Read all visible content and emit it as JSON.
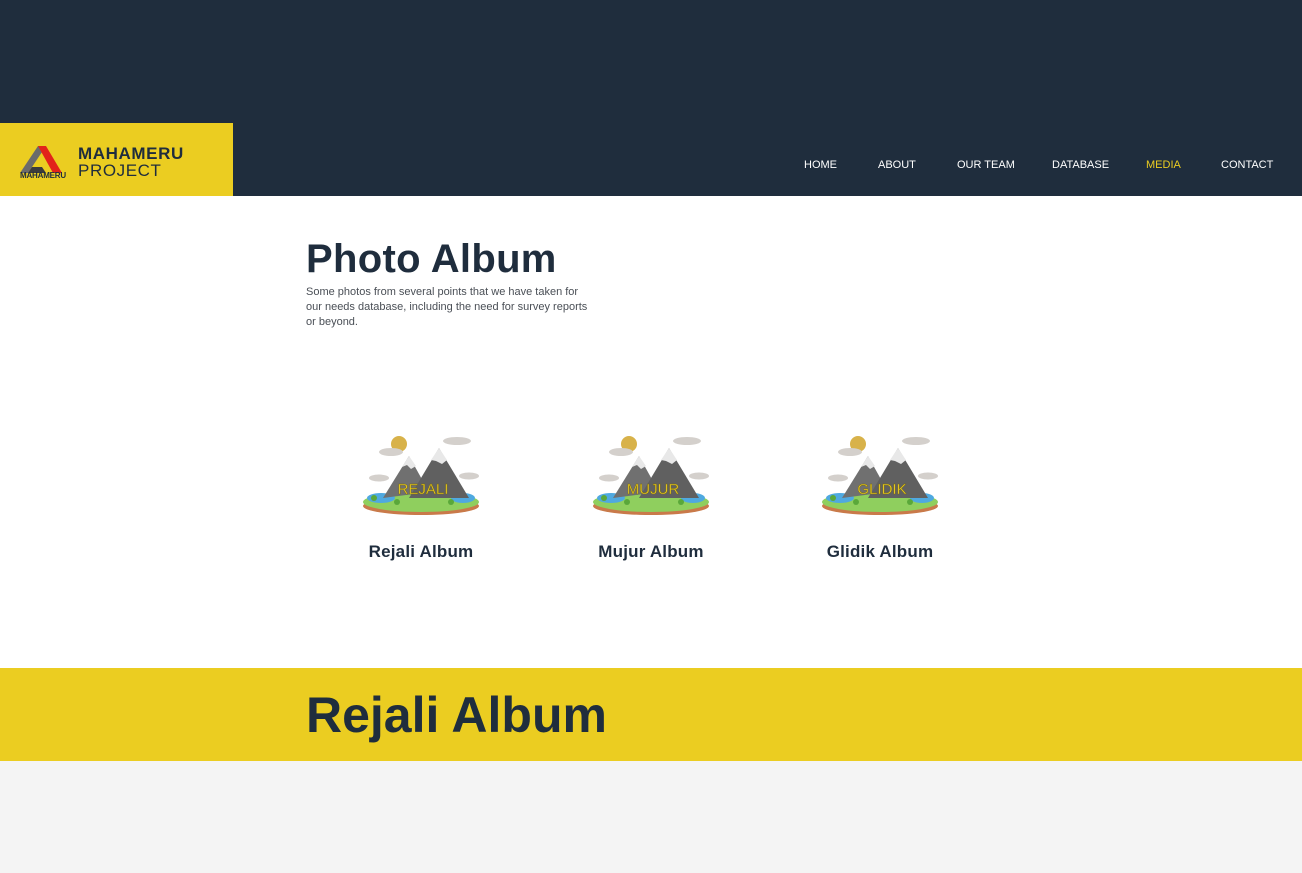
{
  "brand": {
    "name": "MAHAMERU",
    "sub": "PROJECT",
    "mark_caption": "MAHAMERU"
  },
  "nav": {
    "items": [
      {
        "label": "HOME"
      },
      {
        "label": "ABOUT"
      },
      {
        "label": "OUR TEAM"
      },
      {
        "label": "DATABASE"
      },
      {
        "label": "MEDIA",
        "active": true
      },
      {
        "label": "CONTACT"
      }
    ]
  },
  "main": {
    "title": "Photo Album",
    "description": "Some photos from several points that we have taken for our needs database, including the need for survey reports or beyond.",
    "albums": [
      {
        "badge": "REJALI",
        "title": "Rejali Album"
      },
      {
        "badge": "MUJUR",
        "title": "Mujur Album"
      },
      {
        "badge": "GLIDIK",
        "title": "Glidik Album"
      }
    ]
  },
  "banner": {
    "title": "Rejali Album"
  },
  "colors": {
    "navy": "#1f2d3d",
    "yellow": "#ebcd21",
    "white": "#ffffff",
    "light_gray": "#f4f4f4"
  }
}
